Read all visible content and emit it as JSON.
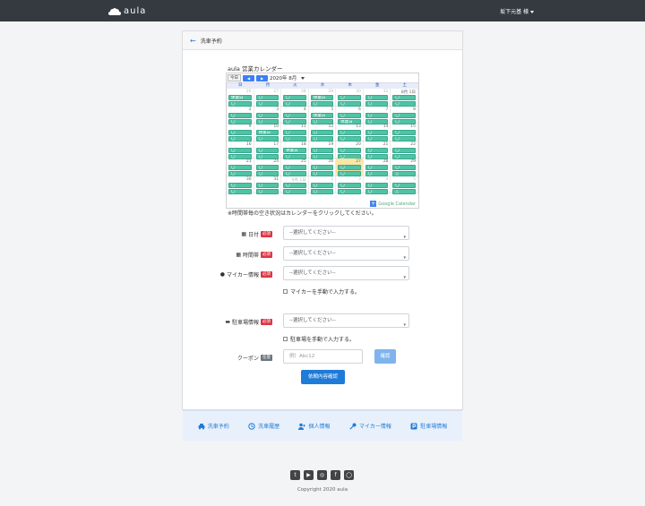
{
  "nav": {
    "brand": "aula",
    "user": "坂下元基 様"
  },
  "page": {
    "title": "洗車予約"
  },
  "calendar": {
    "title": "aula 営業カレンダー",
    "today_label": "今日",
    "month_label": "2020年 8月",
    "weekdays": [
      "日",
      "月",
      "火",
      "水",
      "木",
      "金",
      "土"
    ],
    "weeks": [
      [
        {
          "d": "26",
          "o": true,
          "e": [
            "休業日",
            "〇"
          ]
        },
        {
          "d": "27",
          "o": true,
          "e": [
            "〇",
            "〇"
          ]
        },
        {
          "d": "28",
          "o": true,
          "e": [
            "〇",
            "〇"
          ]
        },
        {
          "d": "29",
          "o": true,
          "e": [
            "休業日",
            "〇"
          ]
        },
        {
          "d": "30",
          "o": true,
          "e": [
            "〇",
            "〇"
          ]
        },
        {
          "d": "31",
          "o": true,
          "e": [
            "〇",
            "〇"
          ]
        },
        {
          "d": "8月 1日",
          "o": false,
          "e": [
            "〇",
            "〇"
          ]
        }
      ],
      [
        {
          "d": "2",
          "o": false,
          "e": [
            "〇",
            "〇"
          ]
        },
        {
          "d": "3",
          "o": false,
          "e": [
            "〇",
            "〇"
          ]
        },
        {
          "d": "4",
          "o": false,
          "e": [
            "〇",
            "〇"
          ]
        },
        {
          "d": "5",
          "o": false,
          "e": [
            "休業日",
            "〇"
          ]
        },
        {
          "d": "6",
          "o": false,
          "e": [
            "〇",
            "休業日"
          ]
        },
        {
          "d": "7",
          "o": false,
          "e": [
            "〇",
            "〇"
          ]
        },
        {
          "d": "8",
          "o": false,
          "e": [
            "〇",
            "〇"
          ]
        }
      ],
      [
        {
          "d": "9",
          "o": false,
          "e": [
            "〇",
            "〇"
          ]
        },
        {
          "d": "10",
          "o": false,
          "e": [
            "休業日",
            "〇"
          ]
        },
        {
          "d": "11",
          "o": false,
          "e": [
            "〇",
            "〇"
          ]
        },
        {
          "d": "12",
          "o": false,
          "e": [
            "〇",
            "〇"
          ]
        },
        {
          "d": "13",
          "o": false,
          "e": [
            "〇",
            "〇"
          ]
        },
        {
          "d": "14",
          "o": false,
          "e": [
            "〇",
            "〇"
          ]
        },
        {
          "d": "15",
          "o": false,
          "e": [
            "〇",
            "〇"
          ]
        }
      ],
      [
        {
          "d": "16",
          "o": false,
          "e": [
            "〇",
            "〇"
          ]
        },
        {
          "d": "17",
          "o": false,
          "e": [
            "〇",
            "〇"
          ]
        },
        {
          "d": "18",
          "o": false,
          "e": [
            "休業日",
            "〇"
          ]
        },
        {
          "d": "19",
          "o": false,
          "e": [
            "〇",
            "〇"
          ]
        },
        {
          "d": "20",
          "o": false,
          "e": [
            "〇",
            "〇"
          ]
        },
        {
          "d": "21",
          "o": false,
          "e": [
            "〇",
            "〇"
          ]
        },
        {
          "d": "22",
          "o": false,
          "e": [
            "〇",
            "〇"
          ]
        }
      ],
      [
        {
          "d": "23",
          "o": false,
          "e": [
            "〇",
            "〇"
          ]
        },
        {
          "d": "24",
          "o": false,
          "e": [
            "〇",
            "〇"
          ]
        },
        {
          "d": "25",
          "o": false,
          "e": [
            "〇",
            "〇"
          ]
        },
        {
          "d": "26",
          "o": false,
          "e": [
            "〇",
            "〇"
          ]
        },
        {
          "d": "27",
          "o": false,
          "h": true,
          "e": [
            "〇",
            "〇"
          ]
        },
        {
          "d": "28",
          "o": false,
          "e": [
            "〇",
            "〇"
          ]
        },
        {
          "d": "29",
          "o": false,
          "e": [
            "〇",
            "△"
          ]
        }
      ],
      [
        {
          "d": "30",
          "o": false,
          "e": [
            "〇",
            "〇"
          ]
        },
        {
          "d": "31",
          "o": false,
          "e": [
            "〇",
            "〇"
          ]
        },
        {
          "d": "9月 1日",
          "o": true,
          "e": [
            "〇",
            "〇"
          ]
        },
        {
          "d": "2",
          "o": true,
          "e": [
            "〇",
            "〇"
          ]
        },
        {
          "d": "3",
          "o": true,
          "e": [
            "〇",
            "〇"
          ]
        },
        {
          "d": "4",
          "o": true,
          "e": [
            "〇",
            "〇"
          ]
        },
        {
          "d": "5",
          "o": true,
          "e": [
            "〇",
            "△"
          ]
        }
      ]
    ],
    "footer": "Google Calendar",
    "note": "※時間帯毎の空き状況はカレンダーをクリックしてください。"
  },
  "form": {
    "date": {
      "label": "日付",
      "badge": "必須",
      "value": "--選択してください--"
    },
    "time": {
      "label": "時間帯",
      "badge": "必須",
      "value": "--選択してください--"
    },
    "car": {
      "label": "マイカー情報",
      "badge": "必須",
      "value": "--選択してください--",
      "check": "マイカーを手動で入力する。"
    },
    "parking": {
      "label": "駐車場情報",
      "badge": "必須",
      "value": "--選択してください--",
      "check": "駐車場を手動で入力する。"
    },
    "coupon": {
      "label": "クーポン",
      "badge": "任意",
      "placeholder": "例）Abc12",
      "check_button": "確認"
    },
    "submit": "依頼内容確認"
  },
  "footer_nav": [
    {
      "label": "洗車予約",
      "icon": "car-icon"
    },
    {
      "label": "洗車履歴",
      "icon": "history-icon"
    },
    {
      "label": "個人情報",
      "icon": "user-icon"
    },
    {
      "label": "マイカー情報",
      "icon": "key-icon"
    },
    {
      "label": "駐車場情報",
      "icon": "parking-icon"
    }
  ],
  "social": [
    "twitter-icon",
    "youtube-icon",
    "instagram-icon",
    "facebook-icon",
    "line-icon"
  ],
  "copyright": "Copyright 2020 aula"
}
